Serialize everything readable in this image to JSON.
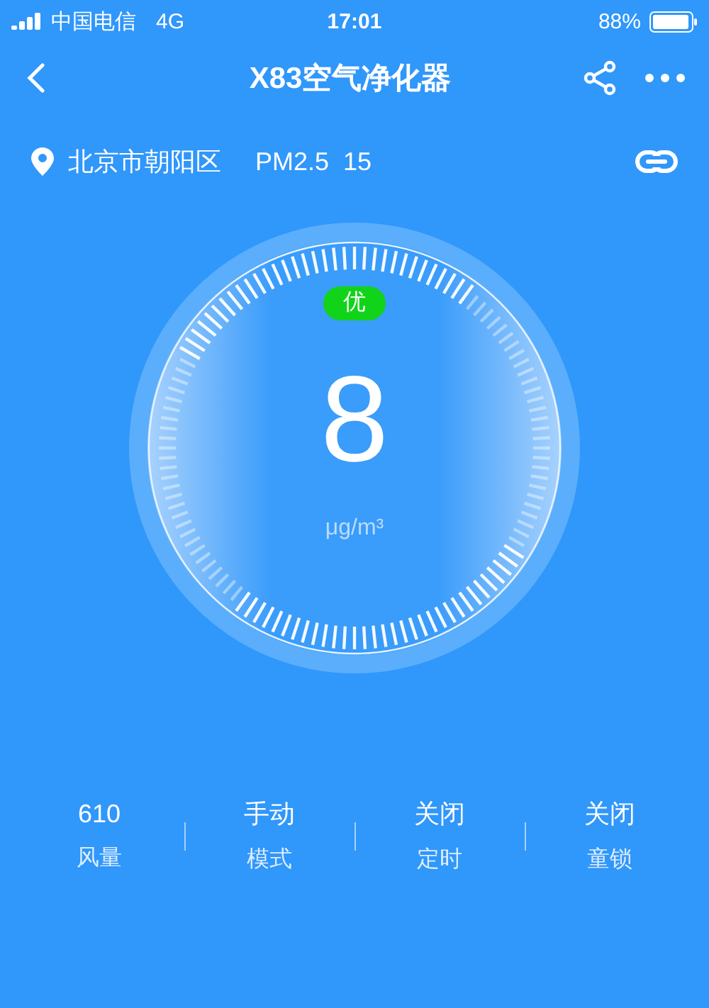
{
  "status_bar": {
    "carrier": "中国电信",
    "network": "4G",
    "time": "17:01",
    "battery": "88%"
  },
  "nav": {
    "title": "X83空气净化器"
  },
  "location": {
    "city": "北京市朝阳区",
    "pm_label": "PM2.5",
    "pm_value": "15"
  },
  "gauge": {
    "quality": "优",
    "color": "#11d31a",
    "value": "8",
    "unit": "μg/m³"
  },
  "stats": [
    {
      "value": "610",
      "label": "风量"
    },
    {
      "value": "手动",
      "label": "模式"
    },
    {
      "value": "关闭",
      "label": "定时"
    },
    {
      "value": "关闭",
      "label": "童锁"
    }
  ]
}
